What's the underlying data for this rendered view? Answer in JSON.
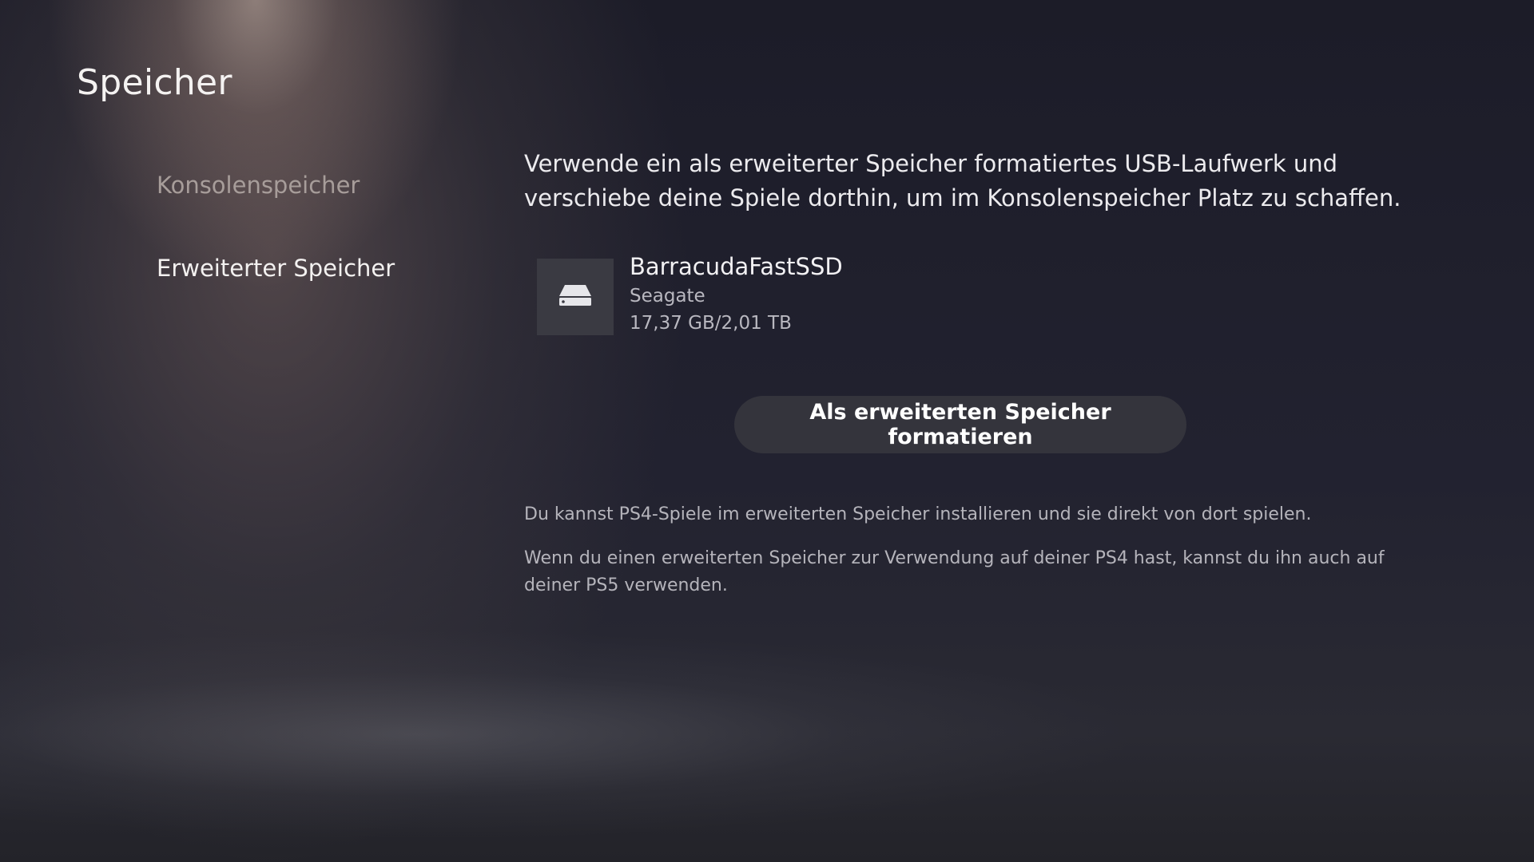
{
  "header": {
    "title": "Speicher"
  },
  "sidebar": {
    "items": [
      {
        "label": "Konsolenspeicher",
        "active": false
      },
      {
        "label": "Erweiterter Speicher",
        "active": true
      }
    ]
  },
  "main": {
    "intro": "Verwende ein als erweiterter Speicher formatiertes USB-Laufwerk und verschiebe deine Spiele dorthin, um im Konsolenspeicher Platz zu schaffen.",
    "device": {
      "icon": "external-drive-icon",
      "name": "BarracudaFastSSD",
      "vendor": "Seagate",
      "capacity": "17,37 GB/2,01 TB"
    },
    "format_button_label": "Als erweiterten Speicher formatieren",
    "notes": [
      "Du kannst PS4-Spiele im erweiterten Speicher installieren und sie direkt von dort spielen.",
      "Wenn du einen erweiterten Speicher zur Verwendung auf deiner PS4 hast, kannst du ihn auch auf deiner PS5 verwenden."
    ]
  },
  "colors": {
    "background": "#1b1c26",
    "button": "#34343c",
    "active_text": "#f3f1f0",
    "inactive_text": "#a79d9a"
  }
}
